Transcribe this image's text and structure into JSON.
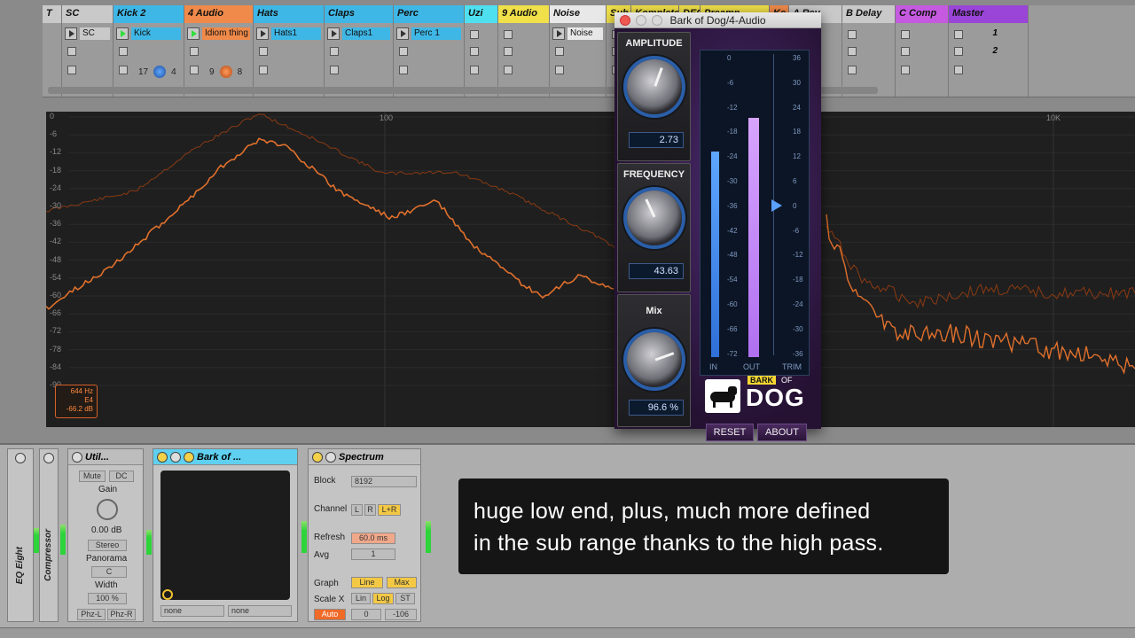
{
  "session": {
    "tracks": [
      {
        "name": "T",
        "color": "#c9c9c9",
        "clip": "",
        "w": 22
      },
      {
        "name": "SC",
        "color": "#c9c9c9",
        "clip": "SC",
        "clip_color": "#c9c9c9",
        "w": 58
      },
      {
        "name": "Kick 2",
        "color": "#3fb7e6",
        "clip": "Kick",
        "clip_color": "#3fb7e6",
        "w": 80,
        "playing": true
      },
      {
        "name": "4 Audio",
        "color": "#f08a4a",
        "clip": "Idiom thing",
        "clip_color": "#f08a4a",
        "w": 78,
        "playing": true
      },
      {
        "name": "Hats",
        "color": "#3fb7e6",
        "clip": "Hats1",
        "clip_color": "#3fb7e6",
        "w": 80
      },
      {
        "name": "Claps",
        "color": "#3fb7e6",
        "clip": "Claps1",
        "clip_color": "#3fb7e6",
        "w": 78
      },
      {
        "name": "Perc",
        "color": "#3fb7e6",
        "clip": "Perc 1",
        "clip_color": "#3fb7e6",
        "w": 80
      },
      {
        "name": "Uzi",
        "color": "#4fe0f0",
        "clip": "",
        "w": 38
      },
      {
        "name": "9 Audio",
        "color": "#f0e04a",
        "clip": "",
        "w": 58
      },
      {
        "name": "Noise",
        "color": "#e8e8e8",
        "clip": "Noise",
        "clip_color": "#e8e8e8",
        "w": 64
      },
      {
        "name": "Sub",
        "color": "#f0e04a",
        "clip": "",
        "w": 28
      },
      {
        "name": "Kompletor",
        "color": "#f0e04a",
        "clip": "",
        "w": 54
      },
      {
        "name": "DEC",
        "color": "#f0e04a",
        "clip": "",
        "w": 24
      },
      {
        "name": "Preamp",
        "color": "#f0e04a",
        "clip": "",
        "w": 78
      },
      {
        "name": "Ke",
        "color": "#f08a4a",
        "clip": "",
        "w": 22
      },
      {
        "name": "A Rev",
        "color": "#c9c9c9",
        "clip": "",
        "w": 60
      },
      {
        "name": "B Delay",
        "color": "#c9c9c9",
        "clip": "",
        "w": 60
      },
      {
        "name": "C Comp",
        "color": "#c55ae0",
        "clip": "",
        "w": 60
      },
      {
        "name": "Master",
        "color": "#9a44d8",
        "clip": "",
        "w": 90
      }
    ],
    "scene_numbers": [
      "1",
      "2"
    ],
    "mini": {
      "kick_send": "17",
      "kick_num": "4",
      "audio_send": "9",
      "audio_num": "8"
    }
  },
  "spectrum": {
    "y_ticks": [
      "0",
      "-6",
      "-12",
      "-18",
      "-24",
      "-30",
      "-36",
      "-42",
      "-48",
      "-54",
      "-60",
      "-66",
      "-72",
      "-78",
      "-84",
      "-90"
    ],
    "x_ticks": [
      "100",
      "10K"
    ],
    "info": {
      "freq": "644 Hz",
      "note": "E4",
      "level": "-66.2 dB"
    },
    "line_color": "#e0702c"
  },
  "plugin": {
    "window_title": "Bark of Dog/4-Audio",
    "amplitude": {
      "label": "AMPLITUDE",
      "value": "2.73"
    },
    "frequency": {
      "label": "FREQUENCY",
      "value": "43.63"
    },
    "mix": {
      "label": "Mix",
      "value": "96.6 %"
    },
    "meter_scale": [
      "0",
      "-6",
      "-12",
      "-18",
      "-24",
      "-30",
      "-36",
      "-42",
      "-48",
      "-54",
      "-60",
      "-66",
      "-72"
    ],
    "trim_scale": [
      "36",
      "30",
      "24",
      "18",
      "12",
      "6",
      "0",
      "-6",
      "-12",
      "-18",
      "-24",
      "-30",
      "-36"
    ],
    "meter_labels": {
      "in": "IN",
      "out": "OUT",
      "trim": "TRIM"
    },
    "in_level": 0.78,
    "out_level": 0.91,
    "logo_top": "BARK",
    "logo_of": "OF",
    "logo_main": "DOG",
    "reset": "RESET",
    "about": "ABOUT"
  },
  "devices": {
    "eq_eight": "EQ Eight",
    "compressor": "Compressor",
    "utility": {
      "title": "Util...",
      "mute": "Mute",
      "dc": "DC",
      "gain_label": "Gain",
      "gain_value": "0.00 dB",
      "stereo": "Stereo",
      "panorama": "Panorama",
      "pan_value": "C",
      "width_label": "Width",
      "width_value": "100 %",
      "phz_l": "Phz-L",
      "phz_r": "Phz-R"
    },
    "bark": {
      "title": "Bark of ...",
      "sel1": "none",
      "sel2": "none"
    },
    "spectrum_dev": {
      "title": "Spectrum",
      "block_label": "Block",
      "block_value": "8192",
      "channel_label": "Channel",
      "ch_l": "L",
      "ch_r": "R",
      "ch_lr": "L+R",
      "refresh_label": "Refresh",
      "refresh_value": "60.0 ms",
      "avg_label": "Avg",
      "avg_value": "1",
      "graph_label": "Graph",
      "graph_line": "Line",
      "graph_max": "Max",
      "scalex_label": "Scale X",
      "scale_lin": "Lin",
      "scale_log": "Log",
      "scale_st": "ST",
      "auto": "Auto",
      "range_lo": "0",
      "range_hi": "-106"
    }
  },
  "caption": {
    "line1": "huge low end, plus, much more defined",
    "line2": "in the sub range thanks to the high pass."
  }
}
